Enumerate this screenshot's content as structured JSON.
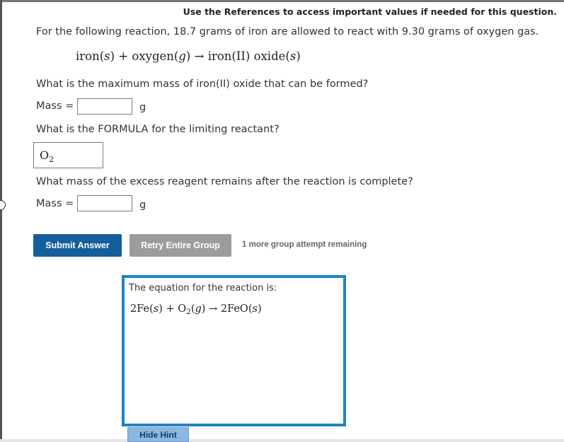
{
  "references_note": "Use the References to access important values if needed for this question.",
  "question_intro": "For the following reaction, 18.7 grams of iron are allowed to react with 9.30 grams of oxygen gas.",
  "reaction": {
    "reactant1": "iron",
    "state1": "s",
    "reactant2": "oxygen",
    "state2": "g",
    "arrow": "→",
    "product": "iron(II) oxide",
    "state3": "s"
  },
  "q1": {
    "text": "What is the maximum mass of iron(II) oxide that can be formed?",
    "label": "Mass =",
    "value": "",
    "unit": "g"
  },
  "q2": {
    "text": "What is the FORMULA for the limiting reactant?",
    "answer_main": "O",
    "answer_sub": "2"
  },
  "q3": {
    "text": "What mass of the excess reagent remains after the reaction is complete?",
    "label": "Mass =",
    "value": "",
    "unit": "g"
  },
  "buttons": {
    "submit": "Submit Answer",
    "retry": "Retry Entire Group",
    "attempts": "1 more group attempt remaining"
  },
  "hint": {
    "title": "The equation for the reaction is:",
    "coef1": "2",
    "reactant1": "Fe",
    "state1": "s",
    "reactant2": "O",
    "reactant2_sub": "2",
    "state2": "g",
    "coef2": "2",
    "product": "FeO",
    "state3": "s",
    "hide_label": "Hide Hint"
  },
  "colors": {
    "submit_button": "#155e9b",
    "retry_button": "#9c9c9c",
    "hint_border": "#1d84c4",
    "hide_hint_button": "#8db7de"
  }
}
